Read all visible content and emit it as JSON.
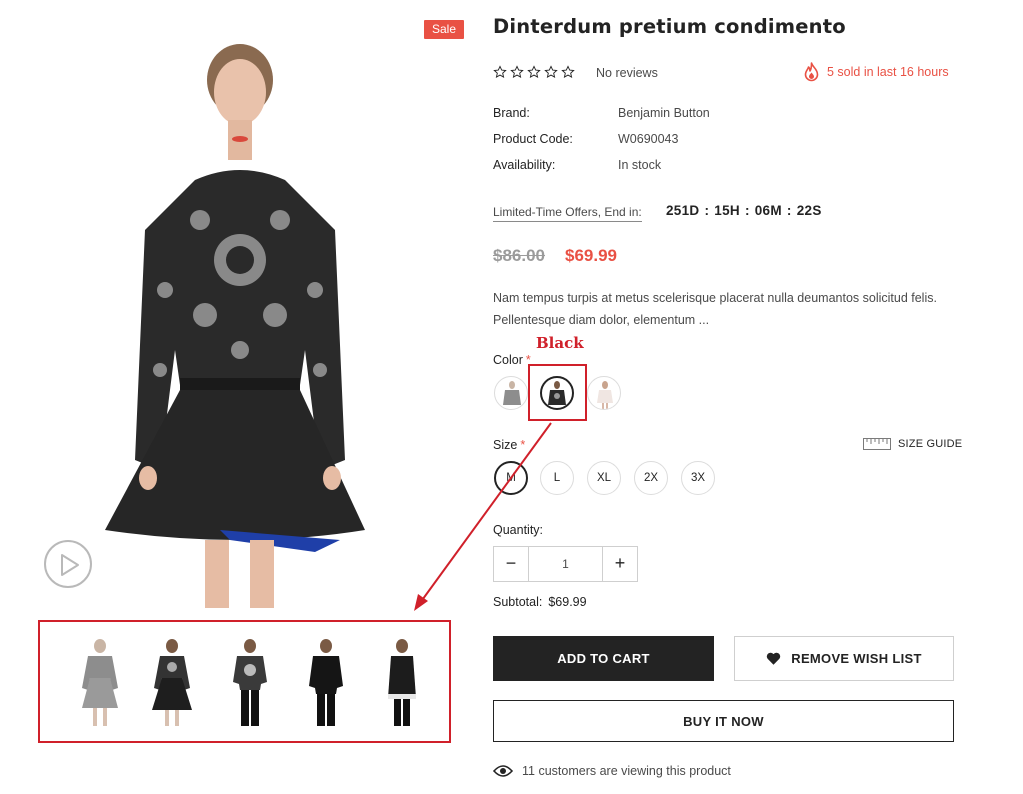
{
  "badge": {
    "sale": "Sale"
  },
  "product": {
    "title": "Dinterdum pretium condimento",
    "rating": 0,
    "reviews_text": "No reviews",
    "sold_text": "5 sold in last 16 hours"
  },
  "specs": [
    {
      "label": "Brand:",
      "value": "Benjamin Button"
    },
    {
      "label": "Product Code:",
      "value": "W0690043"
    },
    {
      "label": "Availability:",
      "value": "In stock"
    }
  ],
  "offer": {
    "label": "Limited-Time Offers, End in:",
    "days": "251D",
    "hours": "15H",
    "minutes": "06M",
    "seconds": "22S",
    "separator": ":"
  },
  "price": {
    "old": "$86.00",
    "new": "$69.99"
  },
  "description": "Nam tempus turpis at metus scelerisque placerat nulla deumantos solicitud felis. Pellentesque diam dolor, elementum ...",
  "annotation": {
    "selected_color_label": "Black"
  },
  "color": {
    "label": "Color",
    "required_mark": "*",
    "swatches": [
      "Grey",
      "Black",
      "White"
    ],
    "selected": "Black"
  },
  "size": {
    "label": "Size",
    "required_mark": "*",
    "guide_label": "SIZE GUIDE",
    "options": [
      "M",
      "L",
      "XL",
      "2X",
      "3X"
    ],
    "selected": "M"
  },
  "quantity": {
    "label": "Quantity:",
    "value": "1",
    "minus": "−",
    "plus": "+"
  },
  "subtotal": {
    "label": "Subtotal:",
    "value": "$69.99"
  },
  "buttons": {
    "add_to_cart": "ADD TO CART",
    "remove_wish": "REMOVE WISH LIST",
    "buy_now": "BUY IT NOW"
  },
  "viewers_text": "11 customers are viewing this product",
  "colors": {
    "accent": "#e95144",
    "annotation": "#d0202a",
    "dark": "#232323"
  },
  "icons": [
    "star-icon",
    "fire-icon",
    "play-icon",
    "ruler-icon",
    "heart-icon",
    "eye-icon"
  ]
}
